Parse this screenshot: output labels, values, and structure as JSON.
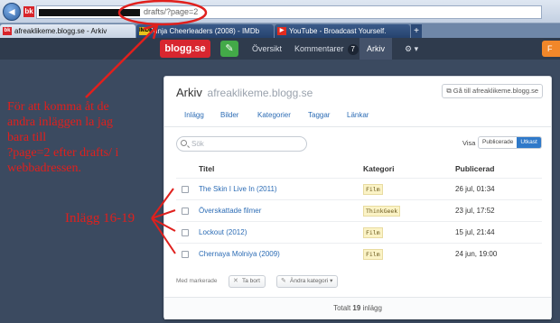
{
  "browser": {
    "url_visible": "drafts/?page=2",
    "tabs": [
      {
        "favicon": "bk",
        "label": "afreaklikeme.blogg.se - Arkiv"
      },
      {
        "favicon": "IMDb",
        "label": "Ninja Cheerleaders (2008) - IMDb"
      },
      {
        "favicon": "yt",
        "label": "YouTube - Broadcast Yourself."
      }
    ],
    "new_tab": "+"
  },
  "appbar": {
    "logo": "blogg.se",
    "compose_icon": "edit-icon",
    "nav": {
      "oversikt": "Översikt",
      "kommentarer": "Kommentarer",
      "kommentarer_count": "7",
      "arkiv": "Arkiv"
    },
    "right_button": "F"
  },
  "card": {
    "title": "Arkiv",
    "site": "afreaklikeme.blogg.se",
    "goto_button": "Gå till afreaklikeme.blogg.se",
    "tabs": [
      "Inlägg",
      "Bilder",
      "Kategorier",
      "Taggar",
      "Länkar"
    ],
    "search_placeholder": "Sök",
    "visa_label": "Visa",
    "filter": {
      "publicerade": "Publicerade",
      "utkast": "Utkast"
    },
    "columns": {
      "title": "Titel",
      "category": "Kategori",
      "published": "Publicerad"
    },
    "rows": [
      {
        "title": "The Skin I Live In (2011)",
        "category": "Film",
        "date": "26 jul, 01:34"
      },
      {
        "title": "Överskattade filmer",
        "category": "ThinkGeek",
        "date": "23 jul, 17:52"
      },
      {
        "title": "Lockout (2012)",
        "category": "Film",
        "date": "15 jul, 21:44"
      },
      {
        "title": "Chernaya Molniya (2009)",
        "category": "Film",
        "date": "24 jun, 19:00"
      }
    ],
    "marked_label": "Med markerade",
    "delete_button": "Ta bort",
    "change_category_button": "Ändra kategori",
    "total_prefix": "Totalt",
    "total_count": "19",
    "total_suffix": "inlägg"
  },
  "annotations": {
    "note_lines": [
      "För att komma åt de",
      "andra inläggen la jag",
      "bara till",
      "?page=2 efter drafts/ i",
      "webbadressen."
    ],
    "rows_label": "Inlägg 16-19",
    "color": "#e0201d"
  }
}
